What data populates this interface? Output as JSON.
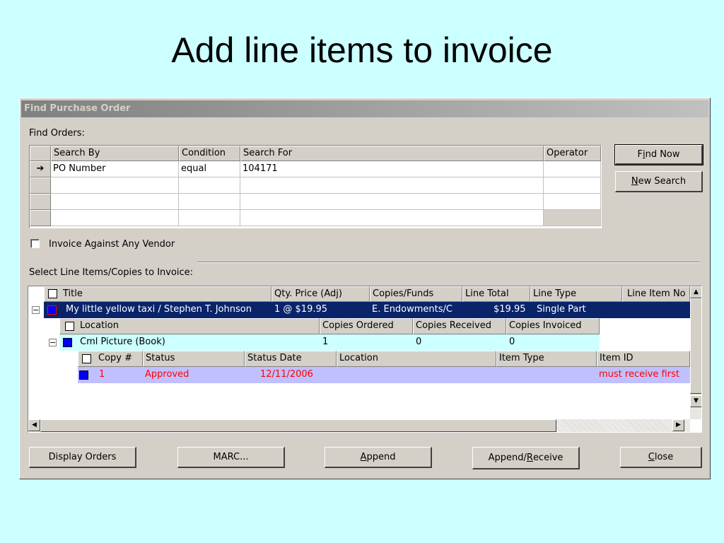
{
  "slide": {
    "title": "Add line items to invoice"
  },
  "dialog": {
    "title": "Find Purchase Order",
    "find_orders_label": "Find Orders:",
    "criteria_headers": [
      "Search By",
      "Condition",
      "Search For",
      "Operator"
    ],
    "criteria_rows": [
      {
        "search_by": "PO Number",
        "condition": "equal",
        "search_for": "104171",
        "operator": ""
      }
    ],
    "row_indicator": "➔",
    "find_now": {
      "pre": "F",
      "acc": "i",
      "post": "nd Now"
    },
    "new_search": {
      "pre": "",
      "acc": "N",
      "post": "ew Search"
    },
    "invoice_any_vendor_label": "Invoice Against Any Vendor",
    "select_line_items_label": "Select Line Items/Copies to Invoice:",
    "line_headers": [
      "Title",
      "Qty.  Price (Adj)",
      "Copies/Funds",
      "Line Total",
      "Line Type",
      "Line Item No"
    ],
    "line_item": {
      "title": "My little yellow taxi / Stephen T. Johnson",
      "qty_price": "1 @ $19.95",
      "copies_funds": "E. Endowments/C",
      "line_total": "$19.95",
      "line_type": "Single Part"
    },
    "location_headers": [
      "Location",
      "Copies Ordered",
      "Copies Received",
      "Copies Invoiced"
    ],
    "location_row": {
      "location": "Cml Picture (Book)",
      "ordered": "1",
      "received": "0",
      "invoiced": "0"
    },
    "copy_headers": [
      "Copy #",
      "Status",
      "Status Date",
      "Location",
      "Item Type",
      "Item ID"
    ],
    "copy_row": {
      "copy_no": "1",
      "status": "Approved",
      "status_date": "12/11/2006",
      "location": "",
      "item_type": "",
      "item_id": "must receive first"
    },
    "buttons": {
      "display_orders": "Display Orders",
      "marc": "MARC...",
      "append": {
        "pre": "",
        "acc": "A",
        "post": "ppend"
      },
      "append_receive": {
        "pre": "Append/",
        "acc": "R",
        "post": "eceive"
      },
      "close": {
        "pre": "",
        "acc": "C",
        "post": "lose"
      }
    },
    "colors": {
      "selected_row_bg": "#0a246a",
      "location_row_bg": "#ccffff",
      "copy_row_bg": "#c0c0ff",
      "copy_row_text": "#ff0000",
      "marker_blue": "#0000ff"
    }
  }
}
